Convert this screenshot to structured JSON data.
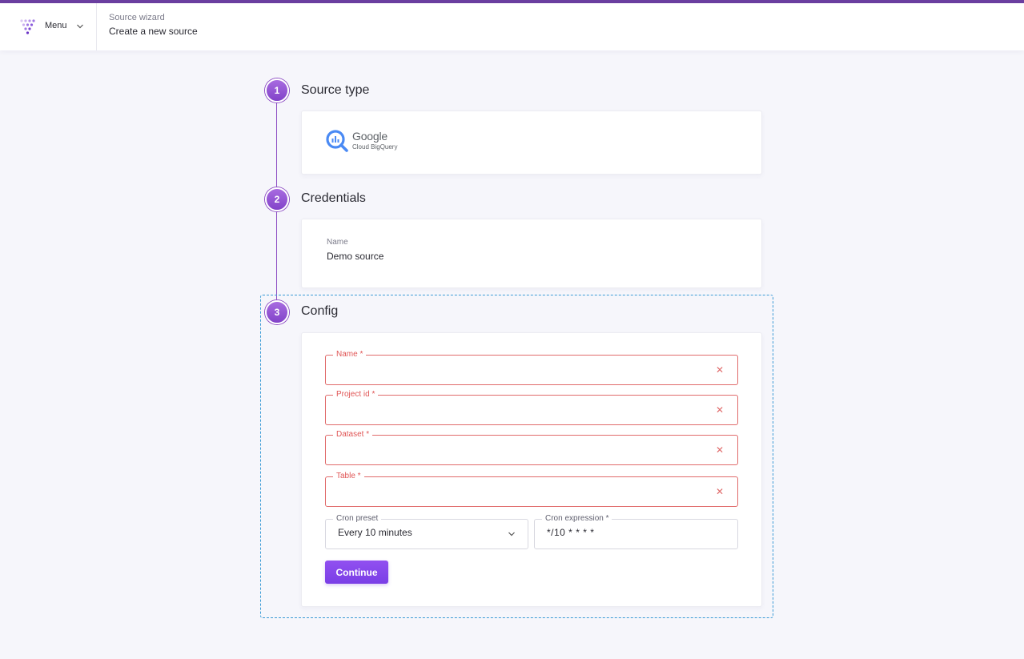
{
  "header": {
    "menu_label": "Menu",
    "breadcrumb_small": "Source wizard",
    "breadcrumb_title": "Create a new source",
    "accent_color": "#6b3fa0"
  },
  "steps": [
    {
      "number": "1",
      "title": "Source type"
    },
    {
      "number": "2",
      "title": "Credentials"
    },
    {
      "number": "3",
      "title": "Config"
    }
  ],
  "source_type": {
    "logo_line1": "Google",
    "logo_line2": "Cloud BigQuery",
    "icon": "bigquery-icon"
  },
  "credentials": {
    "name_label": "Name",
    "name_value": "Demo source"
  },
  "config": {
    "fields": [
      {
        "label": "Name *",
        "value": ""
      },
      {
        "label": "Project id *",
        "value": ""
      },
      {
        "label": "Dataset *",
        "value": ""
      },
      {
        "label": "Table *",
        "value": ""
      }
    ],
    "cron_preset_label": "Cron preset",
    "cron_preset_value": "Every 10 minutes",
    "cron_expression_label": "Cron expression *",
    "cron_expression_value": "*/10 * * * *",
    "continue_label": "Continue",
    "error_color": "#e05555",
    "button_color": "#8a4aed"
  }
}
